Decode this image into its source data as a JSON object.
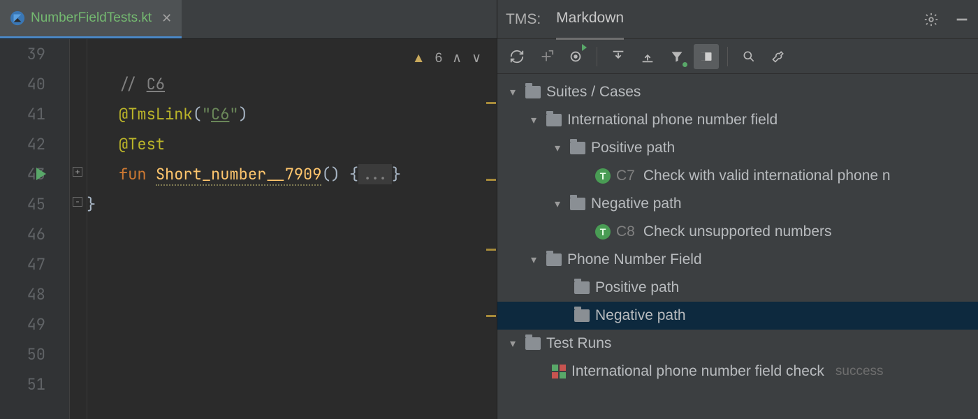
{
  "editor": {
    "tab": {
      "filename": "NumberFieldTests.kt"
    },
    "inspection": {
      "warn_count": "6"
    },
    "gutter": [
      "39",
      "40",
      "41",
      "42",
      "43",
      "45",
      "46",
      "47",
      "48",
      "49",
      "50",
      "51"
    ],
    "lines": {
      "l40_comment_prefix": "// ",
      "l40_comment_link": "C6",
      "l41_ann": "@TmsLink",
      "l41_open": "(",
      "l41_str_open": "\"",
      "l41_str_link": "C6",
      "l41_str_close": "\"",
      "l41_close": ")",
      "l42_ann": "@Test",
      "l43_kw": "fun ",
      "l43_fn": "Short_number__7909",
      "l43_paren": "()",
      "l43_brace_open": " {",
      "l43_fold": "...",
      "l43_brace_close": "}",
      "l45_close": "}"
    }
  },
  "tms": {
    "header": {
      "label": "TMS:",
      "tab": "Markdown"
    },
    "tree": {
      "suites_root": "Suites / Cases",
      "suite1": "International phone number field",
      "suite1_pos": "Positive path",
      "suite1_pos_c7_id": "C7",
      "suite1_pos_c7_txt": "Check with valid international phone n",
      "suite1_neg": "Negative path",
      "suite1_neg_c8_id": "C8",
      "suite1_neg_c8_txt": "Check unsupported numbers",
      "suite2": "Phone Number Field",
      "suite2_pos": "Positive path",
      "suite2_neg": "Negative path",
      "runs_root": "Test Runs",
      "run1": "International phone number field check",
      "run1_status": "success"
    }
  }
}
